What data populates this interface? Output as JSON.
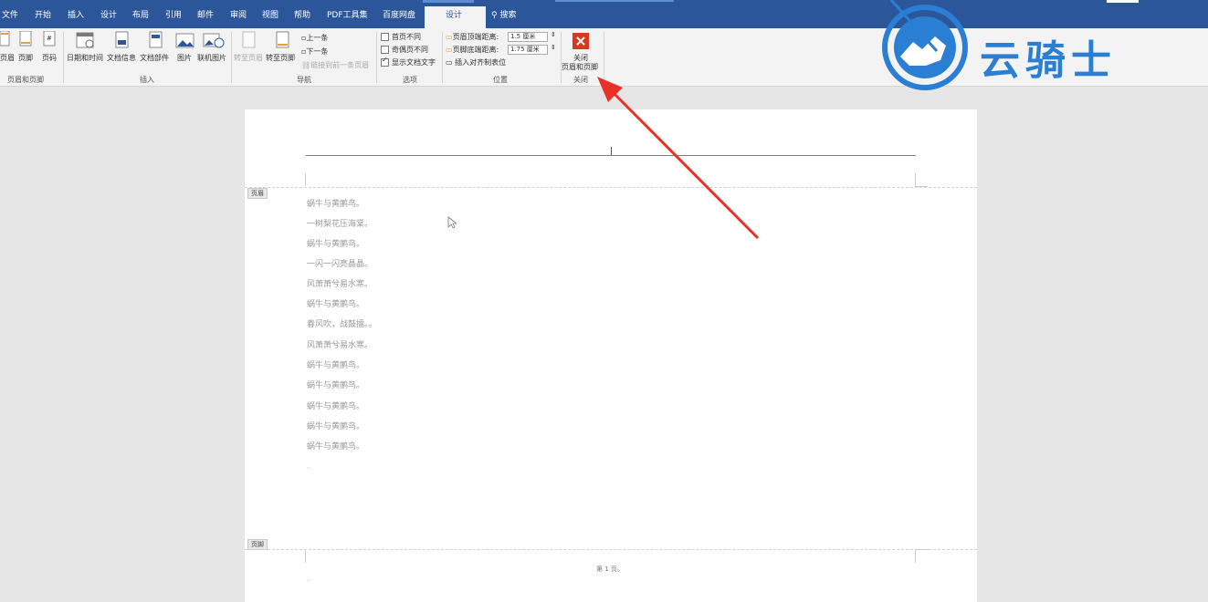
{
  "menubar": {
    "tabs": [
      "文件",
      "开始",
      "插入",
      "设计",
      "布局",
      "引用",
      "邮件",
      "审阅",
      "视图",
      "帮助",
      "PDF工具集",
      "百度网盘",
      "设计"
    ],
    "active_tab": "设计",
    "search": "搜索"
  },
  "ribbon": {
    "hf_group": {
      "header": "页眉",
      "footer": "页脚",
      "page_number": "页码",
      "label": "页眉和页脚"
    },
    "insert_group": {
      "date_time": "日期和时间",
      "doc_info": "文档信息",
      "doc_parts": "文档部件",
      "picture": "图片",
      "online_picture": "联机图片",
      "label": "插入"
    },
    "nav_group": {
      "goto_header": "转至页眉",
      "goto_footer": "转至页脚",
      "prev": "上一条",
      "next": "下一条",
      "link_prev": "链接到前一条页眉",
      "label": "导航"
    },
    "options_group": {
      "first_page": "首页不同",
      "odd_even": "奇偶页不同",
      "show_text": "显示文档文字",
      "label": "选项"
    },
    "position_group": {
      "header_dist_label": "页眉顶端距离:",
      "header_dist_value": "1.5 厘米",
      "footer_dist_label": "页脚底端距离:",
      "footer_dist_value": "1.75 厘米",
      "align_tab": "插入对齐制表位",
      "label": "位置"
    },
    "close_group": {
      "close_line1": "关闭",
      "close_line2": "页眉和页脚",
      "label": "关闭"
    }
  },
  "document": {
    "header_tag": "页眉",
    "footer_tag": "页脚",
    "lines": [
      "蜗牛与黄鹂鸟。",
      "一树梨花压海棠。",
      "蜗牛与黄鹂鸟。",
      "一闪一闪亮晶晶。",
      "风萧萧兮易水寒。",
      "蜗牛与黄鹂鸟。",
      "春风吹，战鼓擂。。",
      "风萧萧兮易水寒。",
      "蜗牛与黄鹂鸟。",
      "蜗牛与黄鹂鸟。",
      "蜗牛与黄鹂鸟。",
      "蜗牛与黄鹂鸟。",
      "蜗牛与黄鹂鸟。"
    ],
    "footer_text": "第 1 页。"
  },
  "watermark": {
    "text": "云骑士"
  },
  "colors": {
    "accent": "#2b579a",
    "arrow": "#e8312b",
    "logo": "#2a7fd4"
  }
}
